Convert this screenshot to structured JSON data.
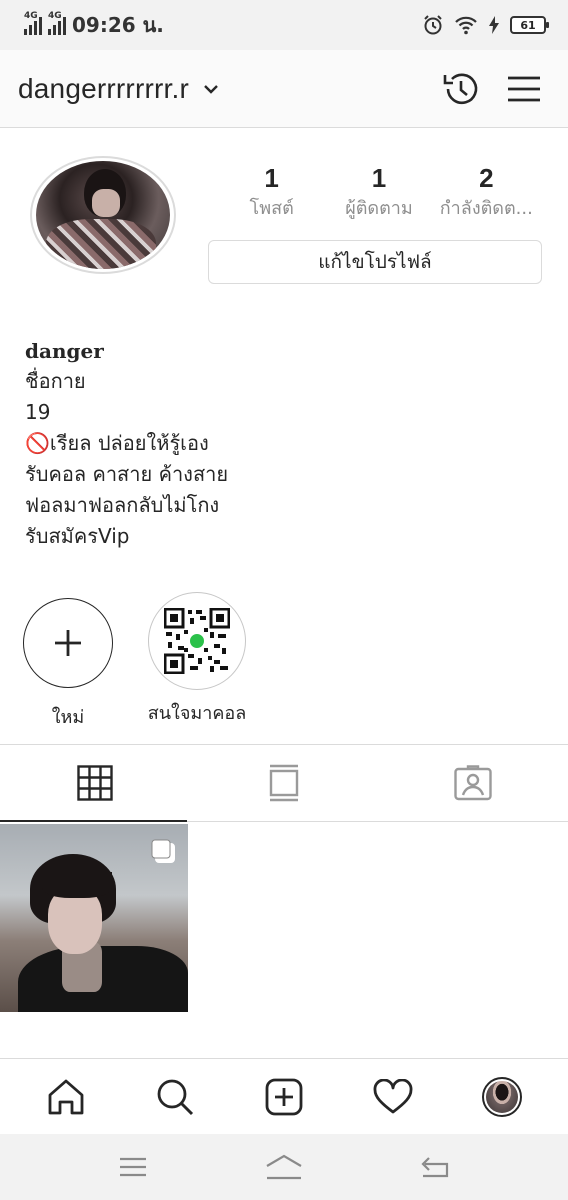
{
  "status_bar": {
    "network_1": "4G",
    "network_2": "4G",
    "time": "09:26 น.",
    "battery": "61"
  },
  "header": {
    "username": "dangerrrrrrrr.r"
  },
  "profile": {
    "stats": [
      {
        "count": "1",
        "label": "โพสต์"
      },
      {
        "count": "1",
        "label": "ผู้ติดตาม"
      },
      {
        "count": "2",
        "label": "กำลังติดต..."
      }
    ],
    "edit_button": "แก้ไขโปรไฟล์"
  },
  "bio": {
    "name": "danger",
    "lines": [
      "ชื่อกาย",
      "19",
      "🚫เรียล ปล่อยให้รู้เอง",
      "รับคอล คาสาย ค้างสาย",
      "ฟอลมาฟอลกลับไม่โกง",
      "รับสมัครVip"
    ]
  },
  "highlights": [
    {
      "label": "ใหม่",
      "icon": "plus-icon"
    },
    {
      "label": "สนใจมาคอล",
      "icon": "qr-code-icon"
    }
  ],
  "tabs": [
    {
      "icon": "grid-icon",
      "active": true
    },
    {
      "icon": "feed-icon",
      "active": false
    },
    {
      "icon": "tagged-icon",
      "active": false
    }
  ],
  "posts": [
    {
      "type": "multi-photo",
      "icon": "multiple-photos-icon"
    }
  ],
  "bottom_nav": [
    "home-icon",
    "search-icon",
    "new-post-icon",
    "activity-heart-icon",
    "profile-avatar"
  ],
  "system_nav": [
    "recents-icon",
    "home-icon",
    "back-icon"
  ],
  "colors": {
    "text": "#262626",
    "secondary_text": "#8e8e8e",
    "border": "#dbdbdb",
    "status_bar_bg": "#f2f2f2",
    "line_green": "#2bc14a"
  }
}
